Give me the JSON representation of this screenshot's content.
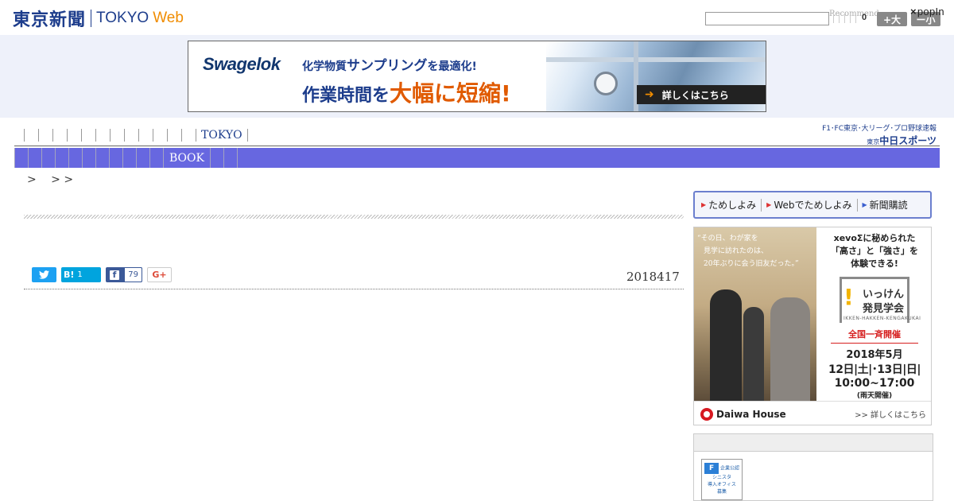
{
  "header": {
    "logo_jp": "東京新聞",
    "logo_en": "TOKYO",
    "logo_web": "Web",
    "search_placeholder": "",
    "recommend": "Recommend",
    "count": "0",
    "font_larger": "+大",
    "font_smaller": "ー小",
    "popin_x": "×",
    "popin": "popIn"
  },
  "top_ad": {
    "brand": "Swagelok",
    "line1_pre": "化学物質",
    "line1_big": "サンプリング",
    "line1_post": "を最適化!",
    "line2_pre": "作業時間を",
    "line2_emph": "大幅に短縮!",
    "cta_arrow": "➜",
    "cta": "詳しくはこちら"
  },
  "nav": {
    "tokyo": "TOKYO",
    "book": "BOOK",
    "breadcrumb": ">　 > >"
  },
  "chunichi": {
    "top": "F1･FC東京･大リーグ･プロ野球速報",
    "prefix": "東京",
    "name": "中日スポーツ"
  },
  "article": {
    "date": "2018417",
    "share": {
      "twitter_icon": "twitter-bird",
      "hatena": "B!",
      "hatena_count": "1",
      "facebook": "f",
      "facebook_count": "79",
      "gplus": "G+"
    }
  },
  "subscribe": {
    "item1": "ためしよみ",
    "item2": "Webでためしよみ",
    "item3": "新聞購読"
  },
  "side_ad": {
    "quote_1": "“その日、わが家を",
    "quote_2": "見学に訪れたのは、",
    "quote_3": "20年ぶりに会う旧友だった。”",
    "head_1": "xevoΣに秘められた",
    "head_2": "「高さ」と「強さ」を",
    "head_3": "体験できる!",
    "badge_mark": "!",
    "badge_1": "いっけん",
    "badge_2": "発見学会",
    "badge_3": "IKKEN-HAKKEN-KENGAKUKAI",
    "nation": "全国一斉開催",
    "date1": "2018年5月",
    "date2": "12日|土|･13日|日|",
    "time": "10:00~17:00",
    "rain": "(雨天開催)",
    "brand": "Daiwa House",
    "more": ">> 詳しくはこちら"
  },
  "side_box": {
    "badge_line1": "企業公認",
    "badge_line2": "シニスタ",
    "badge_line3": "導入オフィス",
    "badge_line4": "募集"
  }
}
